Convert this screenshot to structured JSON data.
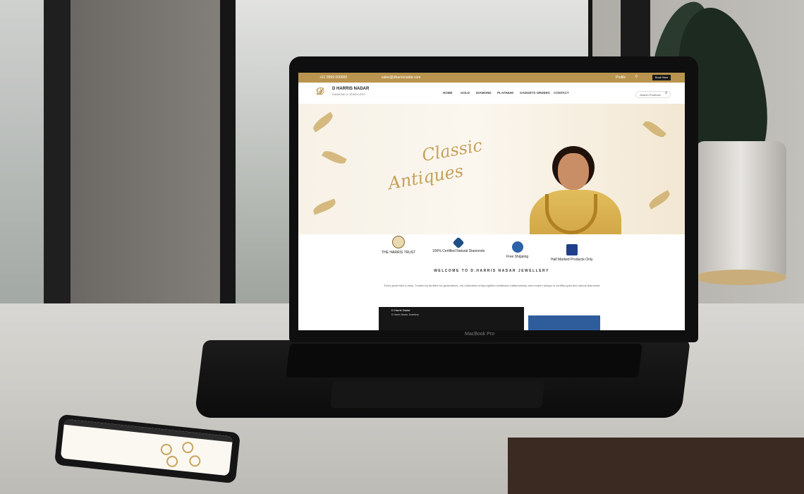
{
  "website": {
    "topbar": {
      "phone": "+91 9999 000000",
      "email": "sales@dharrisnadar.com",
      "account": "Profile",
      "cart": "0",
      "button": "Book Now"
    },
    "brand": {
      "name": "D HARRIS NADAR",
      "tagline": "DIAMOND & JEWELLERY"
    },
    "nav": [
      "HOME",
      "GOLD",
      "DIAMOND",
      "PLATINUM",
      "GADGETS ORDERS",
      "CONTACT"
    ],
    "search": {
      "placeholder": "Search Products"
    },
    "banner": {
      "line1": "Classic",
      "line2": "Antiques"
    },
    "badges": [
      {
        "label": "THE HARRIS TRUST",
        "icon": "hallmark-916-icon"
      },
      {
        "label": "100% Certified Natural Diamonds",
        "icon": "diamond-icon"
      },
      {
        "label": "Free Shipping",
        "icon": "truck-icon"
      },
      {
        "label": "Hall Marked Products Only",
        "icon": "bis-hallmark-icon"
      }
    ],
    "welcome": "WELCOME TO D.HARRIS NADAR JEWELLERY",
    "paragraph": "Every jewel tells a story. Trusted by families for generations, our collections bring together traditional craftsmanship and modern design in certified gold and natural diamonds.",
    "video": {
      "title": "D Harris Nadar",
      "subtitle": "D Harris Nadar Jewellery"
    }
  },
  "device": {
    "laptop_label": "MacBook Pro"
  },
  "colors": {
    "accent_gold": "#b9944e",
    "dark": "#1a1a1a",
    "blue": "#2f5d9c"
  }
}
